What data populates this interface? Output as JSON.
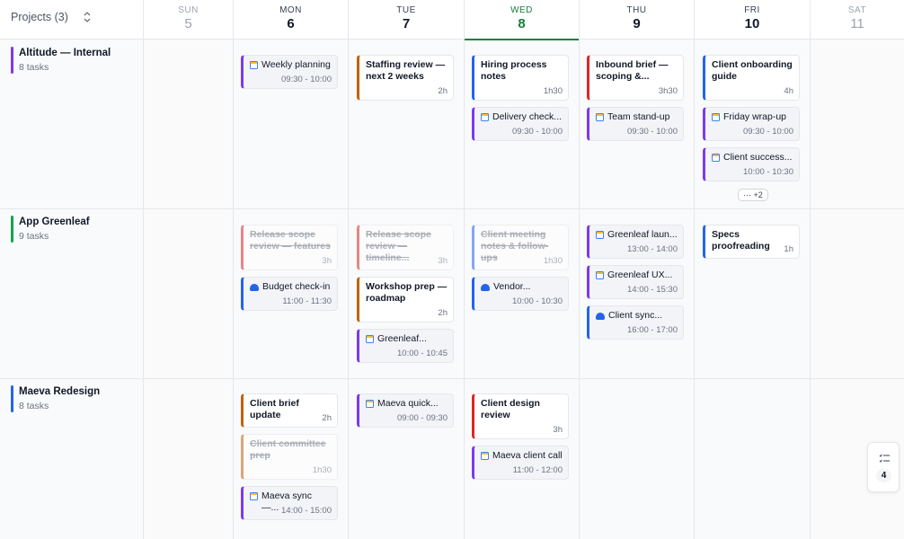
{
  "header": {
    "projects_label": "Projects (3)",
    "days": [
      {
        "name": "SUN",
        "num": "5"
      },
      {
        "name": "MON",
        "num": "6"
      },
      {
        "name": "TUE",
        "num": "7"
      },
      {
        "name": "WED",
        "num": "8"
      },
      {
        "name": "THU",
        "num": "9"
      },
      {
        "name": "FRI",
        "num": "10"
      },
      {
        "name": "SAT",
        "num": "11"
      }
    ]
  },
  "projects": [
    {
      "name": "Altitude — Internal",
      "count": "8 tasks",
      "color": "#7c3aed"
    },
    {
      "name": "App Greenleaf",
      "count": "9 tasks",
      "color": "#16a34a"
    },
    {
      "name": "Maeva Redesign",
      "count": "8 tasks",
      "color": "#2563eb"
    }
  ],
  "cards": {
    "alt_mon_1": {
      "title": "Weekly planning",
      "meta": "09:30 - 10:00"
    },
    "alt_tue_1": {
      "title": "Staffing review — next 2 weeks",
      "meta": "2h"
    },
    "alt_wed_1": {
      "title": "Hiring process notes",
      "meta": "1h30"
    },
    "alt_wed_2": {
      "title": "Delivery check...",
      "meta": "09:30 - 10:00"
    },
    "alt_thu_1": {
      "title": "Inbound brief — scoping &...",
      "meta": "3h30"
    },
    "alt_thu_2": {
      "title": "Team stand-up",
      "meta": "09:30 - 10:00"
    },
    "alt_fri_1": {
      "title": "Client onboarding guide",
      "meta": "4h"
    },
    "alt_fri_2": {
      "title": "Friday wrap-up",
      "meta": "09:30 - 10:00"
    },
    "alt_fri_3": {
      "title": "Client success...",
      "meta": "10:00 - 10:30"
    },
    "alt_fri_more": "+2",
    "gl_mon_1": {
      "title": "Release scope review — features",
      "meta": "3h"
    },
    "gl_mon_2": {
      "title": "Budget check-in",
      "meta": "11:00 - 11:30"
    },
    "gl_tue_1": {
      "title": "Release scope review — timeline...",
      "meta": "3h"
    },
    "gl_tue_2": {
      "title": "Workshop prep — roadmap",
      "meta": "2h"
    },
    "gl_tue_3": {
      "title": "Greenleaf...",
      "meta": "10:00 - 10:45"
    },
    "gl_wed_1": {
      "title": "Client meeting notes & follow-ups",
      "meta": "1h30"
    },
    "gl_wed_2": {
      "title": "Vendor...",
      "meta": "10:00 - 10:30"
    },
    "gl_thu_1": {
      "title": "Greenleaf laun...",
      "meta": "13:00 - 14:00"
    },
    "gl_thu_2": {
      "title": "Greenleaf UX...",
      "meta": "14:00 - 15:30"
    },
    "gl_thu_3": {
      "title": "Client sync...",
      "meta": "16:00 - 17:00"
    },
    "gl_fri_1": {
      "title": "Specs proofreading",
      "meta": "1h"
    },
    "mv_mon_1": {
      "title": "Client brief update",
      "meta": "2h"
    },
    "mv_mon_2": {
      "title": "Client committee prep",
      "meta": "1h30"
    },
    "mv_mon_3": {
      "title": "Maeva sync —...",
      "meta": "14:00 - 15:00"
    },
    "mv_tue_1": {
      "title": "Maeva quick...",
      "meta": "09:00 - 09:30"
    },
    "mv_wed_1": {
      "title": "Client design review",
      "meta": "3h"
    },
    "mv_wed_2": {
      "title": "Maeva client call",
      "meta": "11:00 - 12:00"
    }
  },
  "side_panel": {
    "count": "4",
    "icon": "checklist-icon"
  },
  "colors": {
    "today": "#15803d",
    "purple": "#7c3aed",
    "orange": "#c2620a",
    "blue": "#2563eb",
    "red": "#dc2626"
  }
}
